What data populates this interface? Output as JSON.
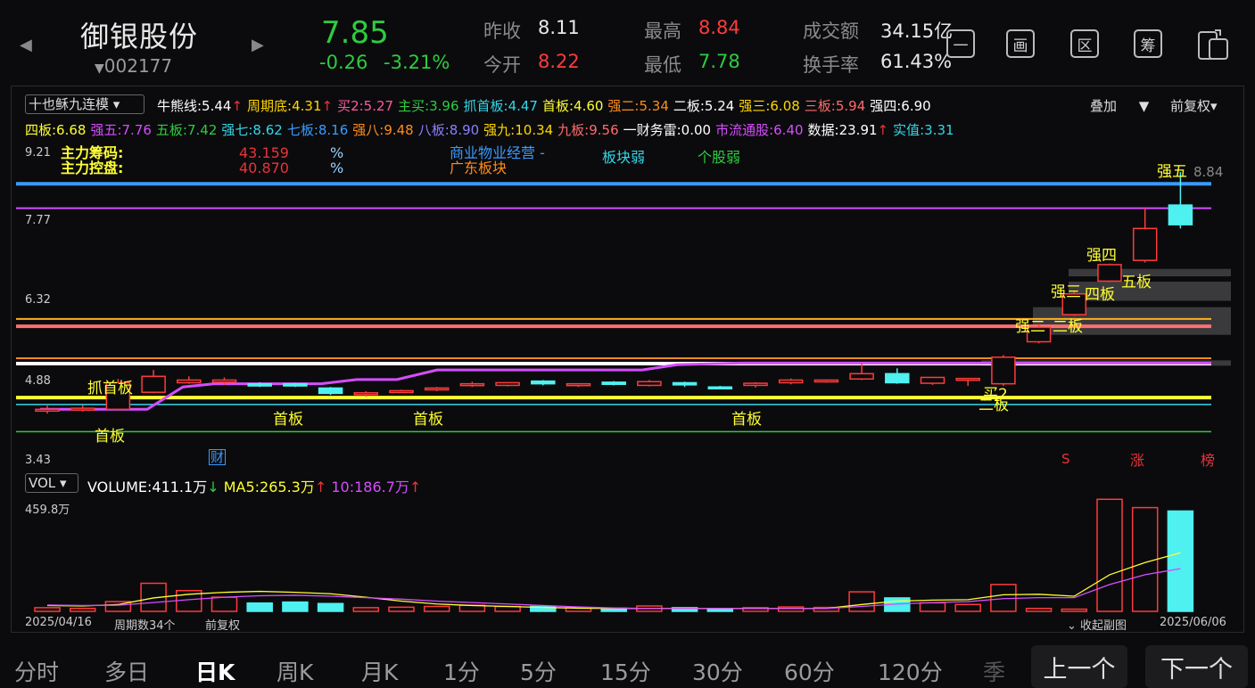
{
  "header": {
    "stock_name": "御银股份",
    "stock_code": "002177",
    "price": "7.85",
    "change": "-0.26",
    "change_pct": "-3.21%",
    "prev_close_label": "昨收",
    "prev_close": "8.11",
    "open_label": "今开",
    "open": "8.22",
    "high_label": "最高",
    "high": "8.84",
    "low_label": "最低",
    "low": "7.78",
    "turnover_label": "成交额",
    "turnover": "34.15亿",
    "turnover_rate_label": "换手率",
    "turnover_rate": "61.43%",
    "toolbar_icons": [
      "minus-box-icon",
      "draw-icon",
      "zone-icon",
      "chip-icon",
      "phone-switch-icon"
    ],
    "toolbar_glyphs": [
      "一",
      "画",
      "区",
      "筹",
      ""
    ]
  },
  "indicator": {
    "selector": "十也稣九连模",
    "overlay": "叠加",
    "adjust": "前复权",
    "items_row1": [
      {
        "t": "牛熊线:5.44",
        "c": "#ffffff",
        "arrow": "↑"
      },
      {
        "t": "周期底:4.31",
        "c": "#ffd700",
        "arrow": "↑"
      },
      {
        "t": "买2:5.27",
        "c": "#ff5a9b"
      },
      {
        "t": "主买:3.96",
        "c": "#2ecc40"
      },
      {
        "t": "抓首板:4.47",
        "c": "#33d6e8"
      },
      {
        "t": "首板:4.60",
        "c": "#ffff33"
      },
      {
        "t": "强二:5.34",
        "c": "#ff8c1a"
      },
      {
        "t": "二板:5.24",
        "c": "#ffffff"
      },
      {
        "t": "强三:6.08",
        "c": "#ffd700"
      },
      {
        "t": "三板:5.94",
        "c": "#ff6b6b"
      },
      {
        "t": "强四:6.90",
        "c": "#ffffff"
      }
    ],
    "items_row2": [
      {
        "t": "四板:6.68",
        "c": "#ffff33"
      },
      {
        "t": "强五:7.76",
        "c": "#d64dff"
      },
      {
        "t": "五板:7.42",
        "c": "#2ecc40"
      },
      {
        "t": "强七:8.62",
        "c": "#33d6e8"
      },
      {
        "t": "七板:8.16",
        "c": "#3b9bff"
      },
      {
        "t": "强八:9.48",
        "c": "#ff8c1a"
      },
      {
        "t": "八板:8.90",
        "c": "#8a7fff"
      },
      {
        "t": "强九:10.34",
        "c": "#ffd700"
      },
      {
        "t": "九板:9.56",
        "c": "#ff6b6b"
      },
      {
        "t": "一财务雷:0.00",
        "c": "#ffffff"
      },
      {
        "t": "市流通股:6.40",
        "c": "#d64dff"
      },
      {
        "t": "数据:23.91",
        "c": "#ffffff",
        "arrow": "↑"
      },
      {
        "t": "实值:3.31",
        "c": "#33d6e8"
      }
    ]
  },
  "chart": {
    "y_ticks": [
      "9.21",
      "7.77",
      "6.32",
      "4.88",
      "3.43"
    ],
    "main_chip_label": "主力筹码:",
    "main_chip_value": "43.159",
    "main_ctrl_label": "主力控盘:",
    "main_ctrl_value": "40.870",
    "pct": "%",
    "sector1": "商业物业经营 -",
    "sector2": "广东板块",
    "sector_weak": "板块弱",
    "stock_weak": "个股弱",
    "high_mark": "8.84",
    "annotations": [
      "抓首板",
      "首板",
      "首板",
      "首板",
      "首板",
      "买2",
      "二板",
      "强二",
      "二板",
      "强三",
      "四板",
      "强四",
      "五板",
      "强五"
    ],
    "markers": {
      "cai": "财",
      "s": "S",
      "zhang": "涨",
      "bang": "榜"
    }
  },
  "chart_data": {
    "type": "candlestick",
    "dates": [
      "2025/04/16",
      "2025/06/06"
    ],
    "ylim": [
      3.43,
      9.21
    ],
    "candles": [
      {
        "o": 4.38,
        "c": 4.38,
        "h": 4.45,
        "l": 4.3
      },
      {
        "o": 4.4,
        "c": 4.4,
        "h": 4.46,
        "l": 4.34
      },
      {
        "o": 4.38,
        "c": 4.88,
        "h": 4.95,
        "l": 4.36
      },
      {
        "o": 4.7,
        "c": 5.0,
        "h": 5.12,
        "l": 4.68
      },
      {
        "o": 4.88,
        "c": 4.93,
        "h": 5.0,
        "l": 4.86
      },
      {
        "o": 4.89,
        "c": 4.93,
        "h": 4.98,
        "l": 4.84
      },
      {
        "o": 4.86,
        "c": 4.82,
        "h": 4.89,
        "l": 4.8
      },
      {
        "o": 4.86,
        "c": 4.82,
        "h": 4.88,
        "l": 4.8
      },
      {
        "o": 4.78,
        "c": 4.68,
        "h": 4.8,
        "l": 4.65
      },
      {
        "o": 4.66,
        "c": 4.69,
        "h": 4.72,
        "l": 4.62
      },
      {
        "o": 4.72,
        "c": 4.73,
        "h": 4.75,
        "l": 4.7
      },
      {
        "o": 4.75,
        "c": 4.78,
        "h": 4.8,
        "l": 4.72
      },
      {
        "o": 4.83,
        "c": 4.86,
        "h": 4.9,
        "l": 4.8
      },
      {
        "o": 4.83,
        "c": 4.88,
        "h": 4.89,
        "l": 4.81
      },
      {
        "o": 4.91,
        "c": 4.86,
        "h": 4.93,
        "l": 4.83
      },
      {
        "o": 4.83,
        "c": 4.86,
        "h": 4.87,
        "l": 4.8
      },
      {
        "o": 4.89,
        "c": 4.85,
        "h": 4.91,
        "l": 4.83
      },
      {
        "o": 4.83,
        "c": 4.9,
        "h": 4.93,
        "l": 4.81
      },
      {
        "o": 4.88,
        "c": 4.84,
        "h": 4.9,
        "l": 4.8
      },
      {
        "o": 4.8,
        "c": 4.79,
        "h": 4.82,
        "l": 4.76
      },
      {
        "o": 4.83,
        "c": 4.87,
        "h": 4.89,
        "l": 4.79
      },
      {
        "o": 4.88,
        "c": 4.93,
        "h": 4.96,
        "l": 4.85
      },
      {
        "o": 4.91,
        "c": 4.93,
        "h": 4.94,
        "l": 4.88
      },
      {
        "o": 4.95,
        "c": 5.05,
        "h": 5.25,
        "l": 4.93
      },
      {
        "o": 5.05,
        "c": 4.88,
        "h": 5.15,
        "l": 4.86
      },
      {
        "o": 4.87,
        "c": 4.98,
        "h": 4.99,
        "l": 4.84
      },
      {
        "o": 4.93,
        "c": 4.96,
        "h": 4.97,
        "l": 4.82
      },
      {
        "o": 4.86,
        "c": 5.36,
        "h": 5.4,
        "l": 4.82
      },
      {
        "o": 5.65,
        "c": 5.92,
        "h": 5.98,
        "l": 5.62
      },
      {
        "o": 6.16,
        "c": 6.55,
        "h": 6.59,
        "l": 6.14
      },
      {
        "o": 6.79,
        "c": 7.1,
        "h": 7.12,
        "l": 6.77
      },
      {
        "o": 7.18,
        "c": 7.78,
        "h": 8.17,
        "l": 7.14
      },
      {
        "o": 8.22,
        "c": 7.85,
        "h": 8.84,
        "l": 7.78
      }
    ],
    "volume": {
      "ymax_label": "459.8万",
      "vol": "411.1万",
      "ma5": "265.3万",
      "ma10": "186.7万",
      "bars": [
        15,
        12,
        40,
        115,
        85,
        58,
        34,
        38,
        32,
        15,
        17,
        20,
        25,
        20,
        20,
        15,
        13,
        22,
        15,
        11,
        15,
        18,
        16,
        80,
        55,
        35,
        28,
        110,
        12,
        9,
        459,
        425,
        411
      ],
      "ma5_line": [
        24,
        22,
        28,
        55,
        70,
        78,
        82,
        78,
        72,
        58,
        42,
        30,
        24,
        20,
        16,
        13,
        12,
        12,
        12,
        12,
        12,
        12,
        12,
        28,
        42,
        46,
        48,
        68,
        70,
        62,
        150,
        200,
        240
      ],
      "ma10_line": [
        26,
        24,
        25,
        36,
        48,
        58,
        64,
        66,
        62,
        56,
        50,
        42,
        36,
        30,
        24,
        18,
        14,
        12,
        12,
        12,
        12,
        12,
        12,
        20,
        30,
        36,
        40,
        52,
        56,
        56,
        110,
        150,
        175
      ]
    }
  },
  "volume_panel": {
    "selector": "VOL",
    "vol_label": "VOLUME:",
    "vol": "411.1万",
    "vol_arrow": "↓",
    "ma5_label": "MA5:",
    "ma5": "265.3万",
    "ma5_arrow": "↑",
    "ma10_label": "10:",
    "ma10": "186.7万",
    "ma10_arrow": "↑",
    "ymax": "459.8万",
    "start_date": "2025/04/16",
    "cycles": "周期数34个",
    "adjust": "前复权",
    "collapse": "收起副图",
    "end_date": "2025/06/06"
  },
  "tabs": [
    "分时",
    "多日",
    "日K",
    "周K",
    "月K",
    "1分",
    "5分",
    "15分",
    "30分",
    "60分",
    "120分",
    "季"
  ],
  "active_tab": "日K",
  "nav_prev": "上一个",
  "nav_next": "下一个"
}
